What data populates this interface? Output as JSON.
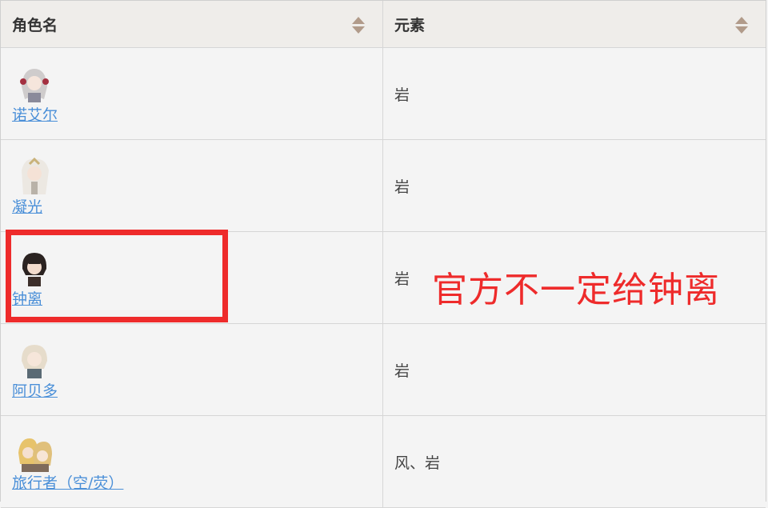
{
  "table": {
    "headers": {
      "name": "角色名",
      "element": "元素"
    },
    "rows": [
      {
        "name": "诺艾尔",
        "element": "岩"
      },
      {
        "name": "凝光",
        "element": "岩"
      },
      {
        "name": "钟离",
        "element": "岩"
      },
      {
        "name": "阿贝多",
        "element": "岩"
      },
      {
        "name": "旅行者（空/荧）",
        "element": "风、岩"
      }
    ]
  },
  "annotation": {
    "text": "官方不一定给钟离",
    "color": "#ee2b2b"
  },
  "link_color": "#4a8fd8"
}
